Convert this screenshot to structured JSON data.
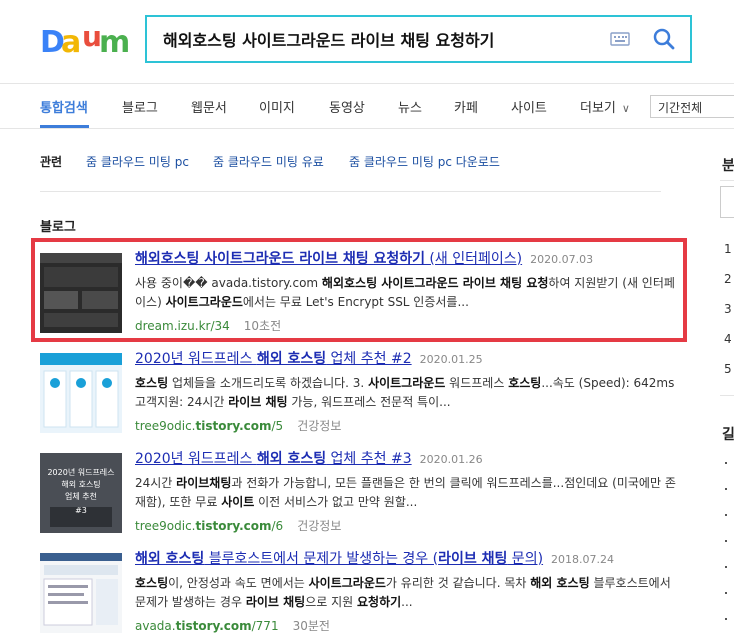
{
  "header": {
    "logo_text": "Daum",
    "search_value": "해외호스팅 사이트그라운드 라이브 채팅 요청하기"
  },
  "tabs": [
    {
      "label": "통합검색"
    },
    {
      "label": "블로그"
    },
    {
      "label": "웹문서"
    },
    {
      "label": "이미지"
    },
    {
      "label": "동영상"
    },
    {
      "label": "뉴스"
    },
    {
      "label": "카페"
    },
    {
      "label": "사이트"
    },
    {
      "label": "더보기"
    }
  ],
  "period_select": "기간전체",
  "related": {
    "label": "관련",
    "items": [
      "줌 클라우드 미팅 pc",
      "줌 클라우드 미팅 유료",
      "줌 클라우드 미팅 pc 다운로드"
    ]
  },
  "section_title": "블로그",
  "results": [
    {
      "title_html": "<b>해외호스팅 사이트그라운드 라이브 채팅 요청하기</b> (새 인터페이스)",
      "date": "2020.07.03",
      "snippet_html": "사용 중이�� avada.tistory.com <span class=\"hl\">해외호스팅 사이트그라운드 라이브 채팅 요청</span>하여 지원받기 (새 인터페이스) <span class=\"hl\">사이트그라운드</span>에서는 무료 Let's Encrypt SSL 인증서를...",
      "url": "dream.izu.kr/34",
      "extra": "10초전"
    },
    {
      "title_html": "2020년 워드프레스 <b>해외 호스팅</b> 업체 추천 #2",
      "date": "2020.01.25",
      "snippet_html": "<span class=\"hl\">호스팅</span> 업체들을 소개드리도록 하겠습니다. 3. <span class=\"hl\">사이트그라운드</span> 워드프레스 <span class=\"hl\">호스팅</span>...속도 (Speed): 642ms 고객지원: 24시간 <span class=\"hl\">라이브 채팅</span> 가능, 워드프레스 전문적 특이...",
      "url_html": "tree9odic.<b>tistory.com</b>/5",
      "extra": "건강정보"
    },
    {
      "title_html": "2020년 워드프레스 <b>해외 호스팅</b> 업체 추천 #3",
      "date": "2020.01.26",
      "snippet_html": "24시간 <span class=\"hl\">라이브채팅</span>과 전화가 가능합니, 모든 플랜들은 한 번의 클릭에 워드프레스를...점인데요 (미국에만 존재함), 또한 무료 <span class=\"hl\">사이트</span> 이전 서비스가 없고 만약 원할...",
      "url_html": "tree9odic.<b>tistory.com</b>/6",
      "extra": "건강정보"
    },
    {
      "title_html": "<b>해외 호스팅</b> 블루호스트에서 문제가 발생하는 경우 (<b>라이브 채팅</b> 문의)",
      "date": "2018.07.24",
      "snippet_html": "<span class=\"hl\">호스팅</span>이, 안정성과 속도 면에서는 <span class=\"hl\">사이트그라운드</span>가 유리한 것 같습니다. 목차 <span class=\"hl\">해외 호스팅</span> 블루호스트에서 문제가 발생하는 경우 <span class=\"hl\">라이브 채팅</span>으로 지원 <span class=\"hl\">요청하기</span>...",
      "url_html": "avada.<b>tistory.com</b>/771",
      "extra": "30분전"
    }
  ],
  "thumb3_text": [
    "2020년 워드프레스",
    "해외 호스팅",
    "업체 추천",
    "#3"
  ],
  "right": {
    "heading1": "분",
    "heading2": "길",
    "nums": [
      "1",
      "2",
      "3",
      "4",
      "5"
    ]
  },
  "colors": {
    "accent": "#3d7dda",
    "search_border": "#2dc3d6",
    "highlight": "#e53a44"
  }
}
